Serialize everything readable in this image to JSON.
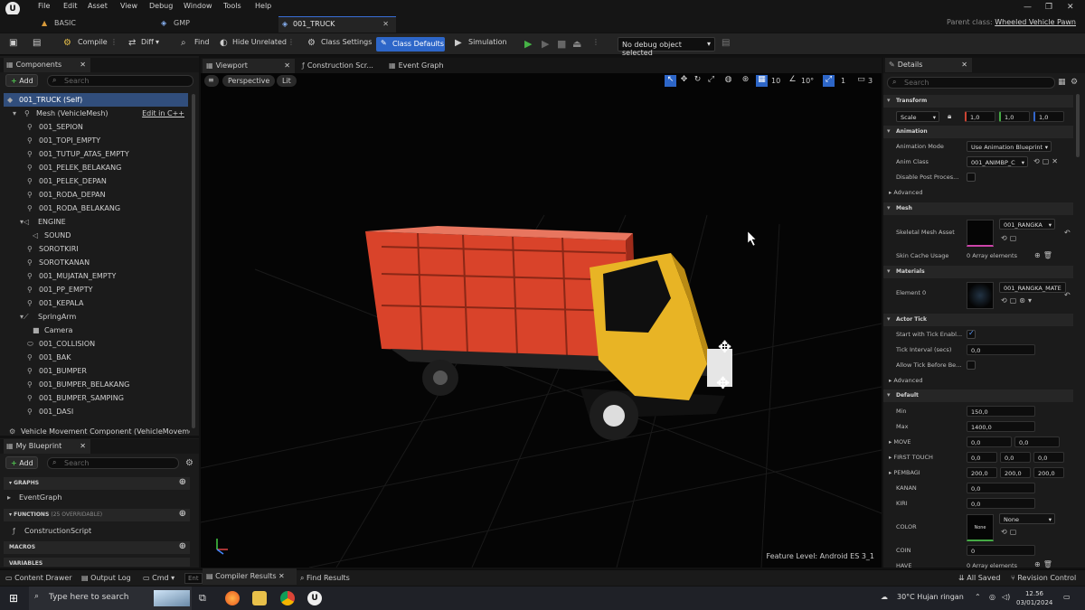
{
  "menu": {
    "items": [
      "File",
      "Edit",
      "Asset",
      "View",
      "Debug",
      "Window",
      "Tools",
      "Help"
    ]
  },
  "tabs": {
    "items": [
      "BASIC",
      "GMP",
      "001_TRUCK"
    ],
    "parent_class_label": "Parent class:",
    "parent_class": "Wheeled Vehicle Pawn"
  },
  "toolbar": {
    "compile": "Compile",
    "diff": "Diff",
    "find": "Find",
    "hide_unrelated": "Hide Unrelated",
    "class_settings": "Class Settings",
    "class_defaults": "Class Defaults",
    "simulation": "Simulation",
    "debug_object": "No debug object selected"
  },
  "components": {
    "tab": "Components",
    "add": "Add",
    "search_placeholder": "Search",
    "root": "001_TRUCK (Self)",
    "mesh": "Mesh (VehicleMesh)",
    "edit_cpp": "Edit in C++",
    "items": [
      "001_SEPION",
      "001_TOPI_EMPTY",
      "001_TUTUP_ATAS_EMPTY",
      "001_PELEK_BELAKANG",
      "001_PELEK_DEPAN",
      "001_RODA_DEPAN",
      "001_RODA_BELAKANG",
      "ENGINE",
      "SOUND",
      "SOROTKIRI",
      "SOROTKANAN",
      "001_MUJATAN_EMPTY",
      "001_PP_EMPTY",
      "001_KEPALA",
      "SpringArm",
      "Camera",
      "001_COLLISION",
      "001_BAK",
      "001_BUMPER",
      "001_BUMPER_BELAKANG",
      "001_BUMPER_SAMPING",
      "001_DASI"
    ],
    "movement": "Vehicle Movement Component (VehicleMoveme"
  },
  "blueprint": {
    "tab": "My Blueprint",
    "add": "Add",
    "search_placeholder": "Search",
    "graphs_hdr": "GRAPHS",
    "event_graph": "EventGraph",
    "functions_hdr": "FUNCTIONS",
    "functions_note": "(25 OVERRIDABLE)",
    "construction": "ConstructionScript",
    "macros_hdr": "MACROS",
    "variables_hdr": "VARIABLES"
  },
  "viewport": {
    "tabs": [
      "Viewport",
      "Construction Scr...",
      "Event Graph"
    ],
    "perspective": "Perspective",
    "lit": "Lit",
    "grid_value": "10",
    "angle_value": "10°",
    "speed_value": "1",
    "cam_value": "3",
    "feature_level_label": "Feature Level:",
    "feature_level": "Android ES 3_1"
  },
  "details": {
    "tab": "Details",
    "search_placeholder": "Search",
    "transform": "Transform",
    "scale_label": "Scale",
    "scale": [
      "1,0",
      "1,0",
      "1,0"
    ],
    "animation": "Animation",
    "anim_mode_label": "Animation Mode",
    "anim_mode": "Use Animation Blueprint",
    "anim_class_label": "Anim Class",
    "anim_class": "001_ANIMBP_C",
    "disable_post_label": "Disable Post Proces...",
    "advanced": "Advanced",
    "mesh": "Mesh",
    "skeletal_label": "Skeletal Mesh Asset",
    "skeletal_value": "001_RANGKA",
    "skin_cache_label": "Skin Cache Usage",
    "skin_cache_value": "0 Array elements",
    "materials": "Materials",
    "element0_label": "Element 0",
    "element0_value": "001_RANGKA_MATE",
    "actor_tick": "Actor Tick",
    "start_tick_label": "Start with Tick Enabl...",
    "tick_interval_label": "Tick Interval (secs)",
    "tick_interval": "0,0",
    "allow_tick_label": "Allow Tick Before Be...",
    "default": "Default",
    "min_label": "Min",
    "min": "150,0",
    "max_label": "Max",
    "max": "1400,0",
    "move_label": "MOVE",
    "move": [
      "0,0",
      "0,0"
    ],
    "first_touch_label": "FIRST TOUCH",
    "first_touch": [
      "0,0",
      "0,0",
      "0,0"
    ],
    "pembagi_label": "PEMBAGI",
    "pembagi": [
      "200,0",
      "200,0",
      "200,0"
    ],
    "kanan_label": "KANAN",
    "kanan": "0,0",
    "kiri_label": "KIRI",
    "kiri": "0,0",
    "color_label": "COLOR",
    "color_swatch": "None",
    "color_value": "None",
    "coin_label": "COIN",
    "coin": "0",
    "have_label": "HAVE",
    "have_value": "0 Array elements"
  },
  "bottom": {
    "content_drawer": "Content Drawer",
    "output_log": "Output Log",
    "cmd": "Cmd",
    "cmd_placeholder": "Ent",
    "compiler_results": "Compiler Results",
    "find_results": "Find Results",
    "all_saved": "All Saved",
    "revision_control": "Revision Control"
  },
  "taskbar": {
    "search": "Type here to search",
    "weather": "30°C  Hujan ringan",
    "time": "12.56",
    "date": "03/01/2024"
  },
  "colors": {
    "accent": "#2d66c8",
    "selection": "#314e7c",
    "truck_cargo": "#d9432a",
    "truck_cab": "#e8b425"
  }
}
